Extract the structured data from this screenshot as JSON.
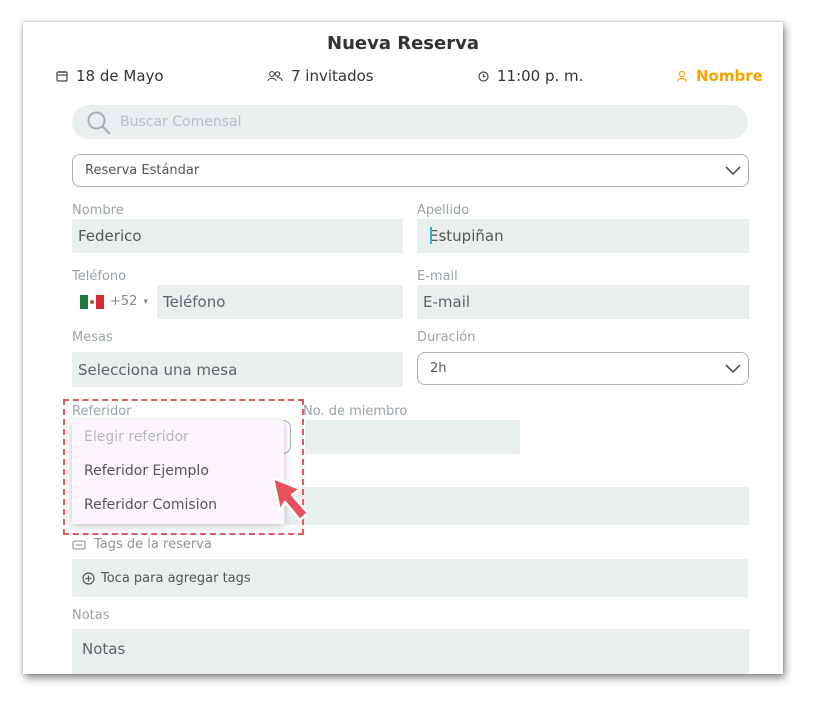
{
  "header": {
    "title": "Nueva Reserva",
    "date": "18 de Mayo",
    "guests": "7 invitados",
    "time": "11:00 p. m.",
    "name_link": "Nombre"
  },
  "search": {
    "placeholder": "Buscar Comensal"
  },
  "reservation_type": {
    "selected": "Reserva Estándar"
  },
  "form": {
    "nombre": {
      "label": "Nombre",
      "value": "Federico"
    },
    "apellido": {
      "label": "Apellido",
      "value": "Estupiñan"
    },
    "telefono": {
      "label": "Teléfono",
      "country_code": "+52",
      "placeholder": "Teléfono"
    },
    "email": {
      "label": "E-mail",
      "placeholder": "E-mail"
    },
    "mesas": {
      "label": "Mesas",
      "placeholder": "Selecciona una mesa"
    },
    "duracion": {
      "label": "Duración",
      "selected": "2h"
    },
    "referidor": {
      "label": "Referidor",
      "placeholder": "Elegir referidor",
      "options": [
        "Referidor Ejemplo",
        "Referidor Comision"
      ]
    },
    "miembro": {
      "label": "No. de miembro"
    },
    "tags": {
      "label": "Tags de la reserva",
      "button": "Toca para agregar tags"
    },
    "notas": {
      "label": "Notas",
      "placeholder": "Notas"
    }
  },
  "colors": {
    "accent_orange": "#f2a500",
    "field_bg": "#e9eeef",
    "highlight_red": "#e05a62",
    "cursor": "#2ab7c0"
  },
  "icons": [
    "calendar-icon",
    "guests-icon",
    "clock-icon",
    "user-icon",
    "search-icon",
    "chevron-down-icon",
    "mexico-flag-icon",
    "tag-icon",
    "plus-circle-icon",
    "pointer-arrow-icon"
  ]
}
